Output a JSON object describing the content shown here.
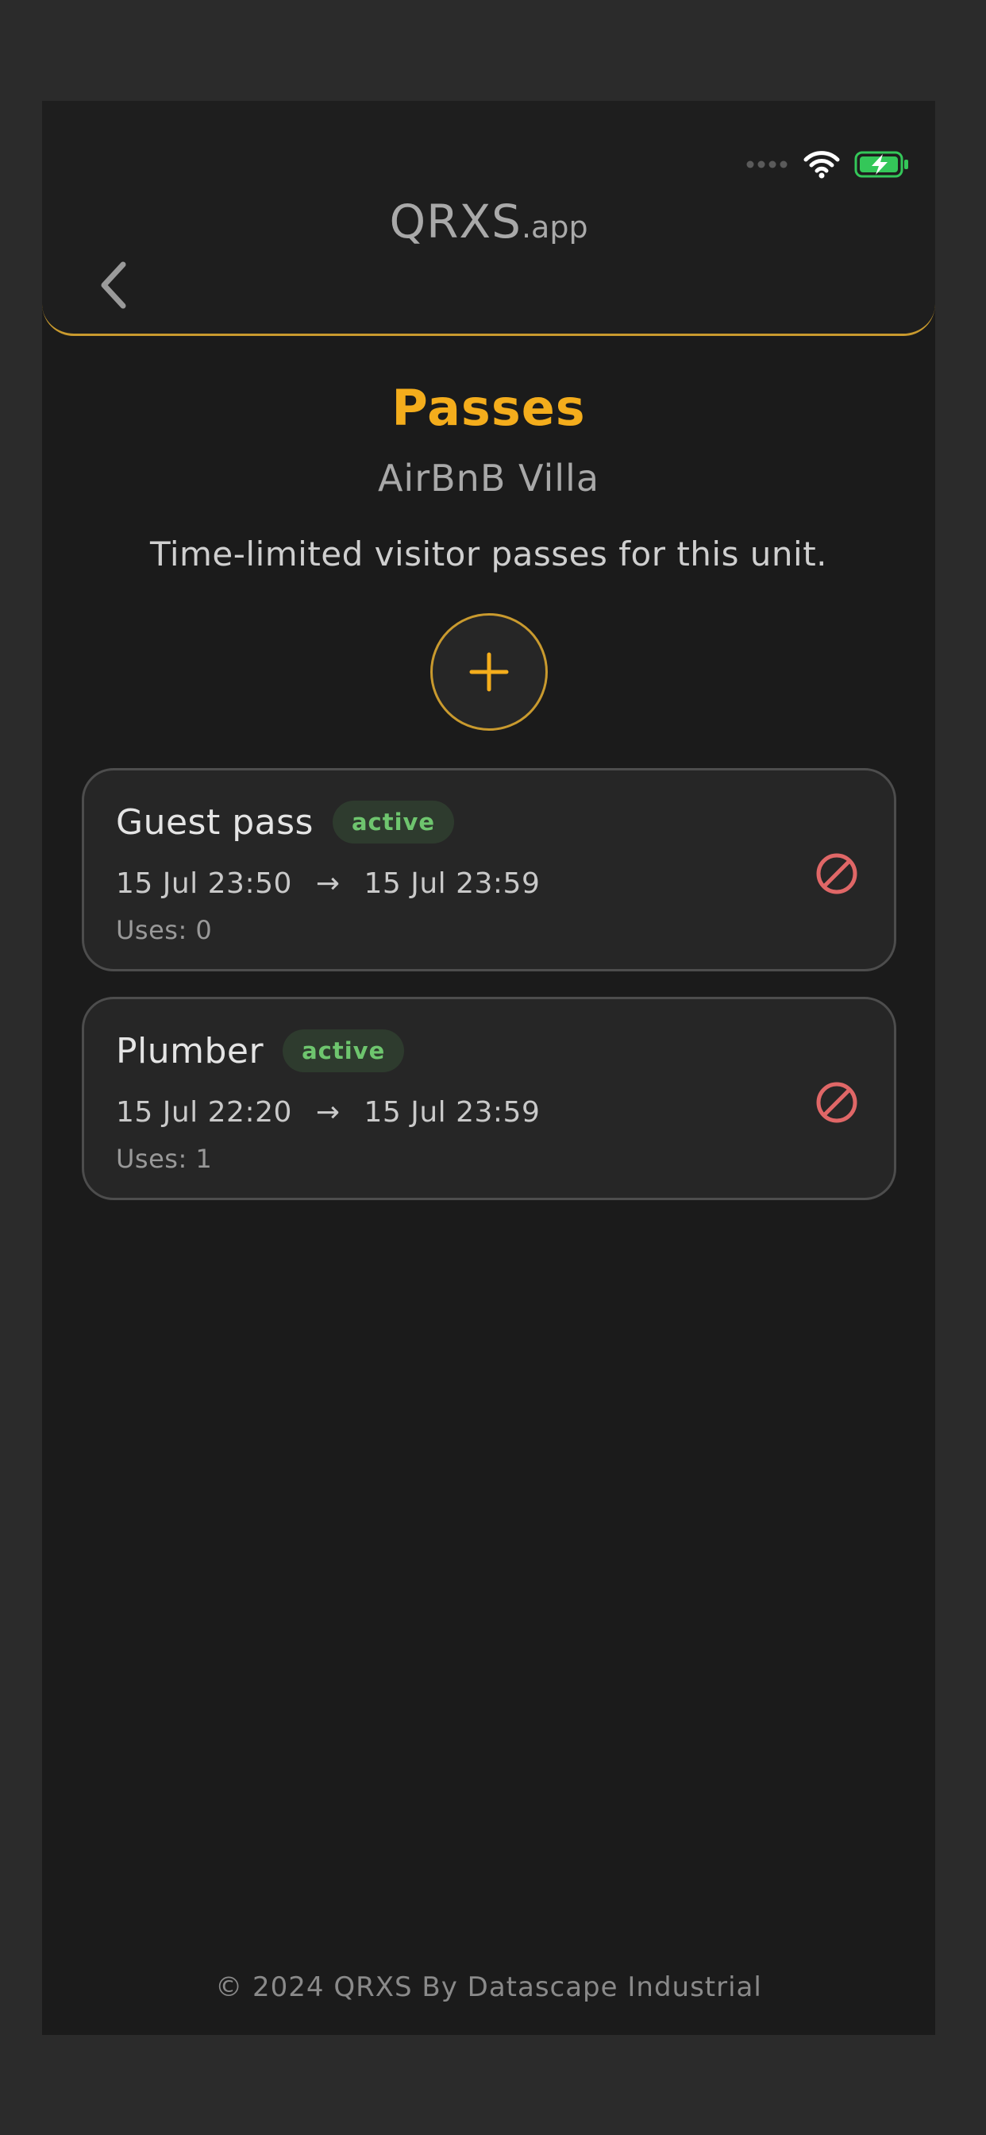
{
  "app": {
    "brand": "QRXS",
    "tld": ".app"
  },
  "status_bar": {
    "icons": [
      "signal-dots-icon",
      "wifi-icon",
      "battery-charging-icon"
    ]
  },
  "header": {
    "back_icon": "chevron-left-icon"
  },
  "page": {
    "title": "Passes",
    "unit_name": "AirBnB Villa",
    "description": "Time-limited visitor passes for this unit.",
    "add_icon": "plus-icon"
  },
  "passes": [
    {
      "name": "Guest pass",
      "status": "active",
      "start": "15 Jul 23:50",
      "arrow": "→",
      "end": "15 Jul 23:59",
      "uses": "Uses: 0",
      "revoke_icon": "block-icon"
    },
    {
      "name": "Plumber",
      "status": "active",
      "start": "15 Jul 22:20",
      "arrow": "→",
      "end": "15 Jul 23:59",
      "uses": "Uses: 1",
      "revoke_icon": "block-icon"
    }
  ],
  "footer": {
    "text": "© 2024 QRXS By Datascape Industrial"
  },
  "colors": {
    "accent": "#f4ad1c",
    "header_border": "#c99a2e",
    "background": "#1b1b1b",
    "active_badge_text": "#6ec56e",
    "revoke": "#e06767",
    "battery": "#34c759"
  }
}
